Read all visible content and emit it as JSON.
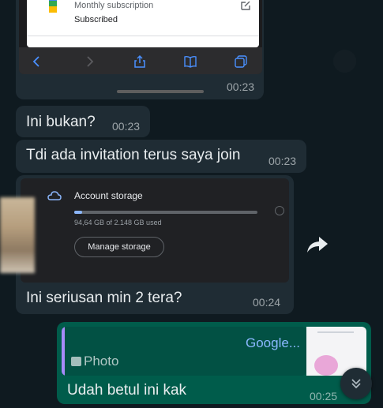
{
  "shot1": {
    "subscription_label": "Monthly subscription",
    "subscription_status": "Subscribed",
    "time": "00:23",
    "icons": [
      "back-icon",
      "forward-icon",
      "share-icon",
      "bookmarks-icon",
      "tabs-icon",
      "edit-icon"
    ]
  },
  "messages": [
    {
      "text": "Ini bukan?",
      "time": "00:23"
    },
    {
      "text": "Tdi ada invitation terus saya join",
      "time": "00:23"
    }
  ],
  "shot2": {
    "title": "Account storage",
    "usage": "94,64 GB of 2.148 GB used",
    "usage_fraction": 0.044,
    "button": "Manage storage",
    "caption": "Ini seriusan min 2 tera?",
    "time": "00:24"
  },
  "reply": {
    "quoted_sender": "Google...",
    "quoted_type": "Photo",
    "text": "Udah betul ini kak",
    "time": "00:25"
  },
  "colors": {
    "incoming": "#1f2c34",
    "outgoing": "#005c4b",
    "quote_bar": "#a78bfa",
    "quoted_sender": "#8bb8ff"
  }
}
